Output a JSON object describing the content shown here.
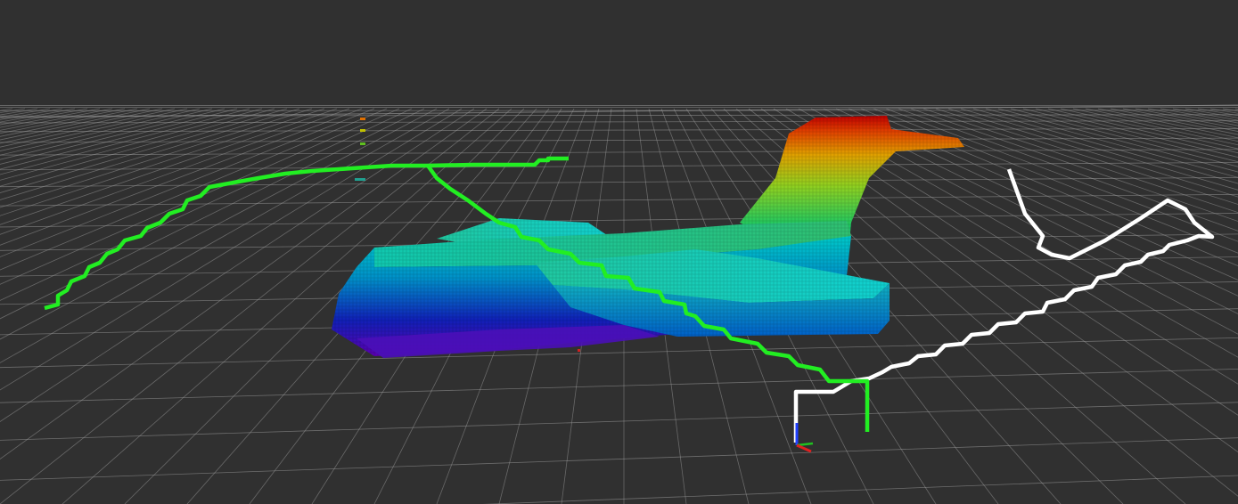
{
  "scene": {
    "background_color": "#303030",
    "grid_color": "#a0a0a0",
    "grid_visible": true,
    "paths": [
      {
        "name": "planned-path-green",
        "color": "#22ee22"
      },
      {
        "name": "trajectory-path-white",
        "color": "#ffffff"
      }
    ],
    "occupancy_map": {
      "color_scale": "height-rainbow",
      "colors": [
        "#5a00b0",
        "#1010c0",
        "#0060d0",
        "#00c0c0",
        "#20d060",
        "#90d020",
        "#e0a000",
        "#e04000",
        "#c00000"
      ]
    },
    "axes": {
      "x_color": "#e02020",
      "y_color": "#20c020",
      "z_color": "#2040ff"
    }
  }
}
